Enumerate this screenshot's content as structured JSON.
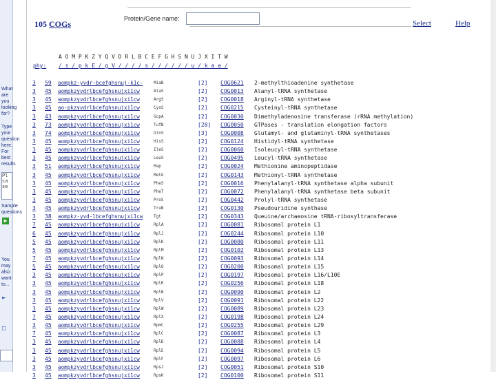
{
  "header": {
    "count": "105",
    "cogs_link": "COGs",
    "protein_label": "Protein/Gene name:",
    "protein_value": "",
    "select_link": "Select",
    "help_link": "Help"
  },
  "sidebar": {
    "question": "What are you looking for?",
    "hint": "Type your question here. For best results",
    "input_value": "Pl ca se",
    "sample": "Sample questions",
    "also": "You may also want to..."
  },
  "letter_header": {
    "letters": "A O M P K Z Y Q V D R L B C E F G H S N U J X I T W",
    "phy": "phy:",
    "slashes": "/ s / p k E / g V / / / / s / / / / / / u / k a e /"
  },
  "rows": [
    {
      "n": "3",
      "num": "59",
      "pat": "aompkz-yvdr-bcefghsnuj-k1c-",
      "gene": "MiaB",
      "br": "[2]",
      "cog": "COG0621",
      "desc": "2-methylthioadenine synthetase"
    },
    {
      "n": "3",
      "num": "45",
      "pat": "aompkzyvdrlbcefghsnujxi1cw",
      "gene": "AlaS",
      "br": "[2]",
      "cog": "COG0013",
      "desc": "Alanyl-tRNA synthetase"
    },
    {
      "n": "3",
      "num": "45",
      "pat": "aompkzyvdrlbcefghsnujxi1cw",
      "gene": "ArgS",
      "br": "[2]",
      "cog": "COG0018",
      "desc": "Arginyl-tRNA synthetase"
    },
    {
      "n": "3",
      "num": "45",
      "pat": "ao-pkzyvdrlbcefghsnujxi1cw",
      "gene": "CysS",
      "br": "[2]",
      "cog": "COG0215",
      "desc": "Cysteinyl-tRNA synthetase"
    },
    {
      "n": "3",
      "num": "43",
      "pat": "aompkzyvdrlbcefghsnujxi1cw",
      "gene": "GcpA",
      "br": "[2]",
      "cog": "COG0030",
      "desc": "Dimethyladenosine transferase (rRNA methylation)"
    },
    {
      "n": "3",
      "num": "73",
      "pat": "aompkzyvdrlbcefghsnujxi1cw",
      "gene": "TufB",
      "br": "[28]",
      "cog": "COG0050",
      "desc": "GTPases - translation elongation factors"
    },
    {
      "n": "3",
      "num": "74",
      "pat": "aompkzyvdrlbcefghsnujxi1cw",
      "gene": "GlnS",
      "br": "[3]",
      "cog": "COG0008",
      "desc": "Glutamyl- and glutaminyl-tRNA synthetases"
    },
    {
      "n": "3",
      "num": "45",
      "pat": "aompkzyvdrlbcefghsnujxi1cw",
      "gene": "HisS",
      "br": "[2]",
      "cog": "COG0124",
      "desc": "Histidyl-tRNA synthetase"
    },
    {
      "n": "3",
      "num": "45",
      "pat": "aompkzyvdrlbcefghsnujxi1cw",
      "gene": "IleS",
      "br": "[2]",
      "cog": "COG0060",
      "desc": "Isoleucyl-tRNA synthetase"
    },
    {
      "n": "3",
      "num": "45",
      "pat": "aompkzyvdrlbcefghsnujxi1cw",
      "gene": "LeuS",
      "br": "[2]",
      "cog": "COG0495",
      "desc": "Leucyl-tRNA synthetase"
    },
    {
      "n": "3",
      "num": "51",
      "pat": "aompkzyvdrlbcefghsnujxi1cw",
      "gene": "Map",
      "br": "[2]",
      "cog": "COG0024",
      "desc": "Methionine aminopeptidase"
    },
    {
      "n": "3",
      "num": "45",
      "pat": "aompkzyvdrlbcefghsnujxi1cw",
      "gene": "MetG",
      "br": "[2]",
      "cog": "COG0143",
      "desc": "Methionyl-tRNA synthetase"
    },
    {
      "n": "3",
      "num": "45",
      "pat": "aompkzyvdrlbcefghsnujxi1cw",
      "gene": "PheS",
      "br": "[2]",
      "cog": "COG0016",
      "desc": "Phenylalanyl-tRNA synthetase alpha subunit"
    },
    {
      "n": "3",
      "num": "45",
      "pat": "aompkzyvdrlbcefghsnujxi1cw",
      "gene": "PheT",
      "br": "[2]",
      "cog": "COG0072",
      "desc": "Phenylalanyl-tRNA synthetase beta subunit"
    },
    {
      "n": "3",
      "num": "45",
      "pat": "aompkzyvdrlbcefghsnujxi1cw",
      "gene": "ProS",
      "br": "[2]",
      "cog": "COG0442",
      "desc": "Prolyl-tRNA synthetase"
    },
    {
      "n": "3",
      "num": "45",
      "pat": "aompkzyvdrlbcefghsnujxi1cw",
      "gene": "TruB",
      "br": "[2]",
      "cog": "COG0130",
      "desc": "Pseudouridine synthase"
    },
    {
      "n": "3",
      "num": "38",
      "pat": "aompkz-yvd-lbcefghsnujxi1cw",
      "gene": "Tgt",
      "br": "[2]",
      "cog": "COG0343",
      "desc": "Queuine/archaeosine tRNA-ribosyltransferase"
    },
    {
      "n": "7",
      "num": "45",
      "pat": "aompkzyvdrlbcefghsnujxi1cw",
      "gene": "RplA",
      "br": "[2]",
      "cog": "COG0081",
      "desc": "Ribosomal protein L1"
    },
    {
      "n": "6",
      "num": "45",
      "pat": "aompkzyvdrlbcefghsnujxi1cw",
      "gene": "RplJ",
      "br": "[2]",
      "cog": "COG0244",
      "desc": "Ribosomal protein L10"
    },
    {
      "n": "5",
      "num": "45",
      "pat": "aompkzyvdrlbcefghsnujxi1cw",
      "gene": "RplK",
      "br": "[2]",
      "cog": "COG0080",
      "desc": "Ribosomal protein L11"
    },
    {
      "n": "5",
      "num": "45",
      "pat": "aompkzyvdrlbcefghsnujxi1cw",
      "gene": "RplM",
      "br": "[2]",
      "cog": "COG0102",
      "desc": "Ribosomal protein L13"
    },
    {
      "n": "7",
      "num": "45",
      "pat": "aompkzyvdrlbcefghsnujxi1cw",
      "gene": "RplN",
      "br": "[2]",
      "cog": "COG0093",
      "desc": "Ribosomal protein L14"
    },
    {
      "n": "5",
      "num": "45",
      "pat": "aompkzyvdrlbcefghsnujxi1cw",
      "gene": "RplO",
      "br": "[2]",
      "cog": "COG0200",
      "desc": "Ribosomal protein L15"
    },
    {
      "n": "3",
      "num": "45",
      "pat": "aompkzyvdrlbcefghsnujxi1cw",
      "gene": "RplP",
      "br": "[2]",
      "cog": "COG0197",
      "desc": "Ribosomal protein L16/L10E"
    },
    {
      "n": "3",
      "num": "45",
      "pat": "aompkzyvdrlbcefghsnujxi1cw",
      "gene": "RplR",
      "br": "[2]",
      "cog": "COG0256",
      "desc": "Ribosomal protein L18"
    },
    {
      "n": "3",
      "num": "45",
      "pat": "aompkzyvdrlbcefghsnujxi1cw",
      "gene": "RplB",
      "br": "[2]",
      "cog": "COG0090",
      "desc": "Ribosomal protein L2"
    },
    {
      "n": "3",
      "num": "45",
      "pat": "aompkzyvdrlbcefghsnujxi1cw",
      "gene": "RplV",
      "br": "[2]",
      "cog": "COG0091",
      "desc": "Ribosomal protein L22"
    },
    {
      "n": "3",
      "num": "45",
      "pat": "aompkzyvdrlbcefghsnujxi1cw",
      "gene": "RplW",
      "br": "[2]",
      "cog": "COG0089",
      "desc": "Ribosomal protein L23"
    },
    {
      "n": "7",
      "num": "45",
      "pat": "aompkzyvdrlbcefghsnujxi1cw",
      "gene": "RplX",
      "br": "[2]",
      "cog": "COG0198",
      "desc": "Ribosomal protein L24"
    },
    {
      "n": "3",
      "num": "45",
      "pat": "aompkzyvdrlbcefghsnujxi1cw",
      "gene": "RpmC",
      "br": "[2]",
      "cog": "COG0255",
      "desc": "Ribosomal protein L29"
    },
    {
      "n": "7",
      "num": "45",
      "pat": "aompkzyvdrlbcefghsnujxi1cw",
      "gene": "RplC",
      "br": "[2]",
      "cog": "COG0087",
      "desc": "Ribosomal protein L3"
    },
    {
      "n": "3",
      "num": "45",
      "pat": "aompkzyvdrlbcefghsnujxi1cw",
      "gene": "RplD",
      "br": "[2]",
      "cog": "COG0088",
      "desc": "Ribosomal protein L4"
    },
    {
      "n": "3",
      "num": "45",
      "pat": "aompkzyvdrlbcefghsnujxi1cw",
      "gene": "RplE",
      "br": "[2]",
      "cog": "COG0094",
      "desc": "Ribosomal protein L5"
    },
    {
      "n": "3",
      "num": "45",
      "pat": "aompkzyvdrlbcefghsnujxi1cw",
      "gene": "RplF",
      "br": "[2]",
      "cog": "COG0097",
      "desc": "Ribosomal protein L6"
    },
    {
      "n": "3",
      "num": "45",
      "pat": "aompkzyvdrlbcefghsnujxi1cw",
      "gene": "RpsJ",
      "br": "[2]",
      "cog": "COG0051",
      "desc": "Ribosomal protein S10"
    },
    {
      "n": "3",
      "num": "45",
      "pat": "aompkzyvdrlbcefghsnujxi1cw",
      "gene": "RpsK",
      "br": "[2]",
      "cog": "COG0100",
      "desc": "Ribosomal protein S11"
    }
  ]
}
